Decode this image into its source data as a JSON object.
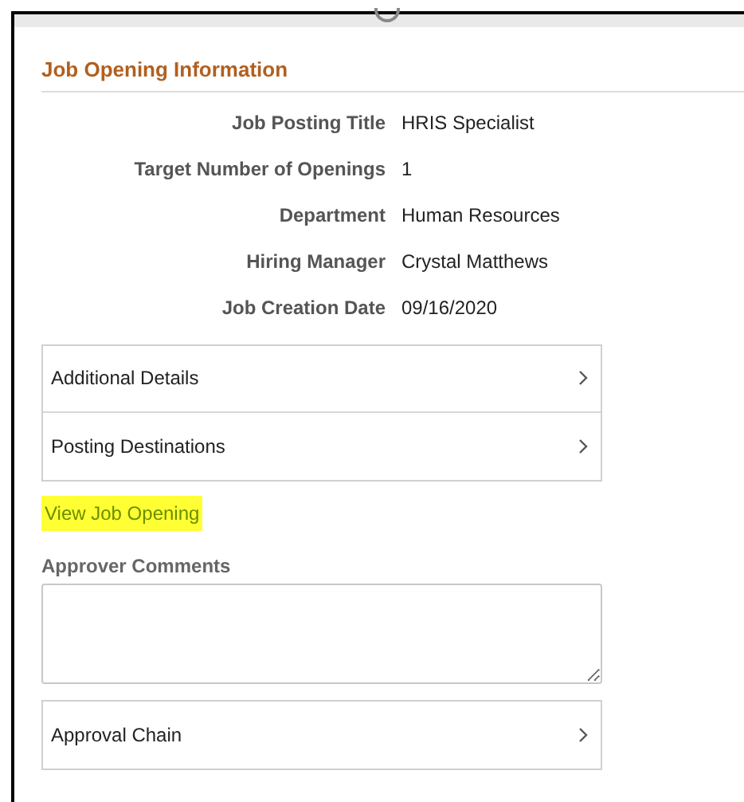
{
  "section": {
    "title": "Job Opening Information"
  },
  "fields": [
    {
      "label": "Job Posting Title",
      "value": "HRIS Specialist"
    },
    {
      "label": "Target Number of Openings",
      "value": "1"
    },
    {
      "label": "Department",
      "value": "Human Resources"
    },
    {
      "label": "Hiring Manager",
      "value": "Crystal Matthews"
    },
    {
      "label": "Job Creation Date",
      "value": "09/16/2020"
    }
  ],
  "detail_rows": [
    {
      "label": "Additional Details"
    },
    {
      "label": "Posting Destinations"
    }
  ],
  "link": {
    "label": "View Job Opening",
    "highlighted": true
  },
  "comments": {
    "label": "Approver Comments"
  },
  "approval_row": {
    "label": "Approval Chain"
  }
}
